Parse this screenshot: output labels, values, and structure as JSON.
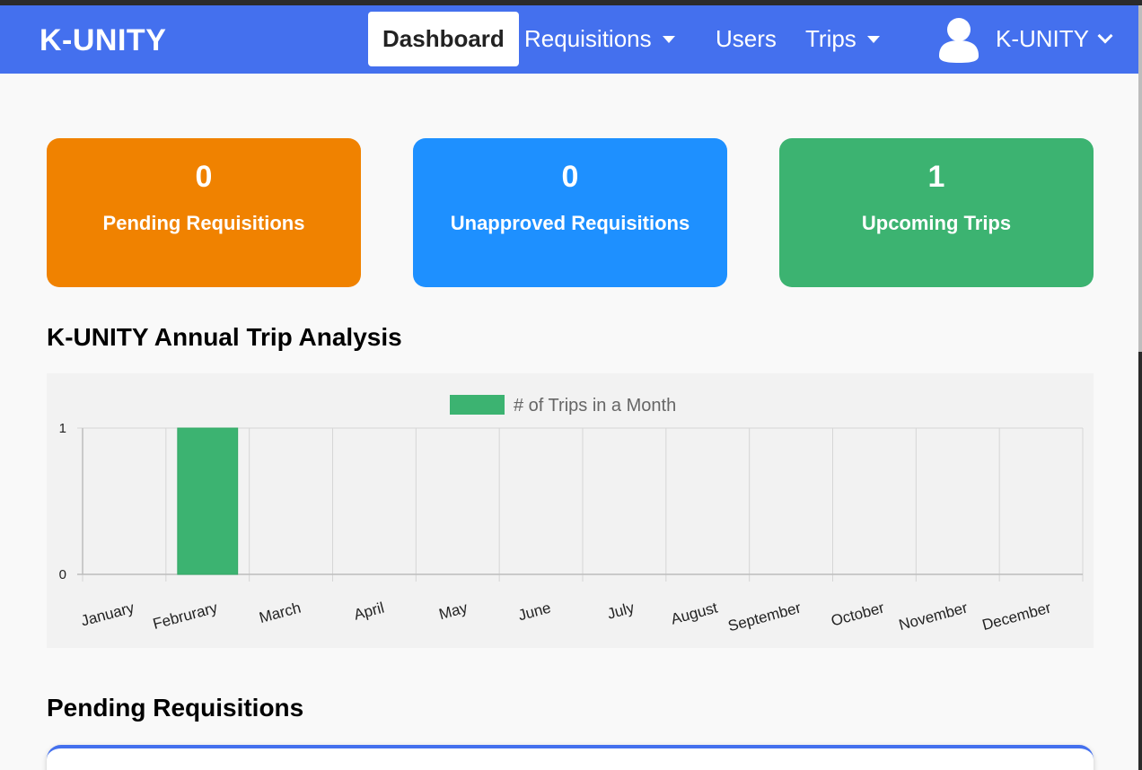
{
  "nav": {
    "brand": "K-UNITY",
    "items": [
      {
        "label": "Dashboard",
        "active": true
      },
      {
        "label": "Requisitions",
        "dropdown": true
      },
      {
        "label": "Users"
      },
      {
        "label": "Trips",
        "dropdown": true
      }
    ],
    "user_label": "K-UNITY"
  },
  "cards": [
    {
      "value": "0",
      "label": "Pending Requisitions",
      "color": "#f08200"
    },
    {
      "value": "0",
      "label": "Unapproved Requisitions",
      "color": "#1e90ff"
    },
    {
      "value": "1",
      "label": "Upcoming Trips",
      "color": "#3cb371"
    }
  ],
  "chart_title": "K-UNITY Annual Trip Analysis",
  "chart_data": {
    "type": "bar",
    "categories": [
      "January",
      "Februrary",
      "March",
      "April",
      "May",
      "June",
      "July",
      "August",
      "September",
      "October",
      "November",
      "December"
    ],
    "series": [
      {
        "name": "# of Trips in a Month",
        "values": [
          0,
          1,
          0,
          0,
          0,
          0,
          0,
          0,
          0,
          0,
          0,
          0
        ],
        "color": "#3cb371"
      }
    ],
    "ylim": [
      0,
      1
    ],
    "yticks": [
      "0",
      "1"
    ],
    "grid": true,
    "legend": "top"
  },
  "pending_title": "Pending Requisitions",
  "colors": {
    "navbar": "#4470ee",
    "page_bg": "#f9f9f9",
    "chart_bg": "#f2f2f2"
  }
}
